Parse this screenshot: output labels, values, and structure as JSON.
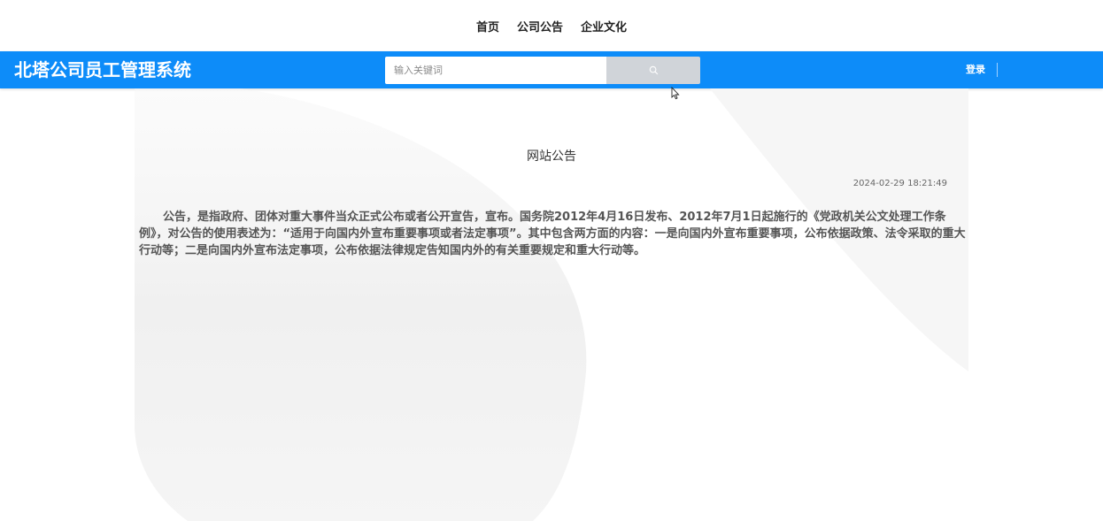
{
  "top_nav": {
    "items": [
      "首页",
      "公司公告",
      "企业文化"
    ]
  },
  "header": {
    "brand": "北塔公司员工管理系统",
    "search_placeholder": "输入关键词",
    "login_label": "登录",
    "bg_color": "#0d8cf9"
  },
  "notice": {
    "title": "网站公告",
    "date": "2024-02-29 18:21:49",
    "content": "公告，是指政府、团体对重大事件当众正式公布或者公开宣告，宣布。国务院2012年4月16日发布、2012年7月1日起施行的《党政机关公文处理工作条例》，对公告的使用表述为：“适用于向国内外宣布重要事项或者法定事项”。其中包含两方面的内容：一是向国内外宣布重要事项，公布依据政策、法令采取的重大行动等；二是向国内外宣布法定事项，公布依据法律规定告知国内外的有关重要规定和重大行动等。"
  },
  "icons": {
    "search": "search-icon",
    "cursor": "mouse-pointer-icon"
  }
}
